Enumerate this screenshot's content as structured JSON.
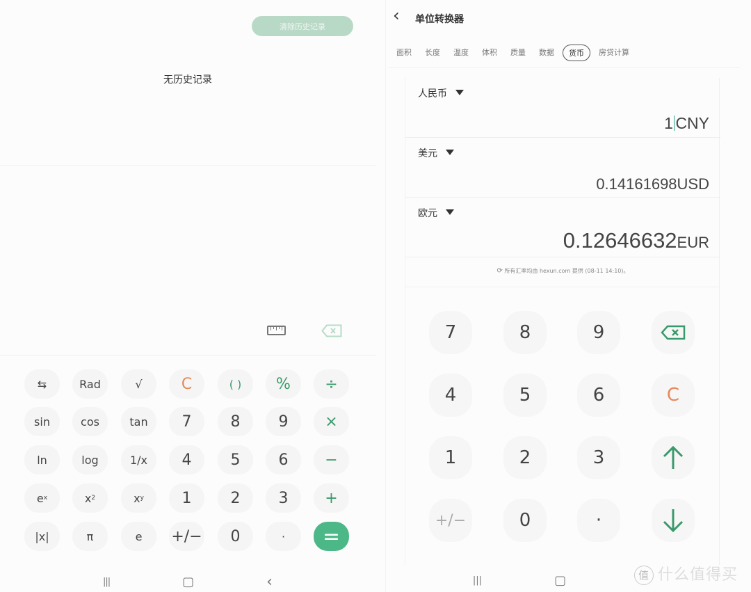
{
  "colors": {
    "accent": "#4cb887",
    "orange": "#e8875a",
    "green_text": "#3a9a6c",
    "clear_button_bg": "#b9d9c7"
  },
  "calculator": {
    "clear_history_label": "清除历史记录",
    "no_history": "无历史记录",
    "icons": {
      "ruler": "ruler-icon",
      "backspace": "backspace-icon"
    },
    "keys": [
      [
        {
          "t": "⇆",
          "n": "swap"
        },
        {
          "t": "Rad",
          "n": "rad"
        },
        {
          "t": "√",
          "n": "sqrt"
        },
        {
          "t": "C",
          "n": "clear",
          "c": "orange"
        },
        {
          "t": "( )",
          "n": "parentheses",
          "c": "green"
        },
        {
          "t": "%",
          "n": "percent",
          "c": "green"
        },
        {
          "t": "÷",
          "n": "divide",
          "c": "green"
        }
      ],
      [
        {
          "t": "sin",
          "n": "sin"
        },
        {
          "t": "cos",
          "n": "cos"
        },
        {
          "t": "tan",
          "n": "tan"
        },
        {
          "t": "7",
          "n": "7"
        },
        {
          "t": "8",
          "n": "8"
        },
        {
          "t": "9",
          "n": "9"
        },
        {
          "t": "×",
          "n": "multiply",
          "c": "green"
        }
      ],
      [
        {
          "t": "ln",
          "n": "ln"
        },
        {
          "t": "log",
          "n": "log"
        },
        {
          "t": "1/x",
          "n": "reciprocal"
        },
        {
          "t": "4",
          "n": "4"
        },
        {
          "t": "5",
          "n": "5"
        },
        {
          "t": "6",
          "n": "6"
        },
        {
          "t": "−",
          "n": "minus",
          "c": "green"
        }
      ],
      [
        {
          "t": "e",
          "s": "x",
          "n": "exp"
        },
        {
          "t": "x",
          "s": "2",
          "n": "square"
        },
        {
          "t": "x",
          "s": "y",
          "n": "power"
        },
        {
          "t": "1",
          "n": "1"
        },
        {
          "t": "2",
          "n": "2"
        },
        {
          "t": "3",
          "n": "3"
        },
        {
          "t": "+",
          "n": "plus",
          "c": "green"
        }
      ],
      [
        {
          "t": "|x|",
          "n": "abs"
        },
        {
          "t": "π",
          "n": "pi"
        },
        {
          "t": "e",
          "n": "e"
        },
        {
          "t": "+/−",
          "n": "negate"
        },
        {
          "t": "0",
          "n": "0"
        },
        {
          "t": "·",
          "n": "decimal"
        },
        {
          "t": "=",
          "n": "equals",
          "c": "accent"
        }
      ]
    ]
  },
  "navbar": {
    "recents": "|||",
    "home": "▢",
    "back": "‹"
  },
  "converter": {
    "back_icon": "‹",
    "title": "单位转换器",
    "tabs": [
      {
        "label": "面积"
      },
      {
        "label": "长度"
      },
      {
        "label": "温度"
      },
      {
        "label": "体积"
      },
      {
        "label": "质量"
      },
      {
        "label": "数据"
      },
      {
        "label": "货币",
        "active": true
      },
      {
        "label": "房贷计算"
      }
    ],
    "currencies": [
      {
        "name": "人民币",
        "value": "1",
        "unit": "CNY"
      },
      {
        "name": "美元",
        "value": "0.14161698",
        "unit": "USD"
      },
      {
        "name": "欧元",
        "value": "0.12646632",
        "unit": "EUR"
      }
    ],
    "source_note": "所有汇率均由 hexun.com 提供 (08-11 14:10)。",
    "keys": [
      [
        {
          "t": "7",
          "n": "7"
        },
        {
          "t": "8",
          "n": "8"
        },
        {
          "t": "9",
          "n": "9"
        },
        {
          "t": "",
          "n": "backspace",
          "icon": "backspace"
        }
      ],
      [
        {
          "t": "4",
          "n": "4"
        },
        {
          "t": "5",
          "n": "5"
        },
        {
          "t": "6",
          "n": "6"
        },
        {
          "t": "C",
          "n": "clear",
          "c": "orange"
        }
      ],
      [
        {
          "t": "1",
          "n": "1"
        },
        {
          "t": "2",
          "n": "2"
        },
        {
          "t": "3",
          "n": "3"
        },
        {
          "t": "",
          "n": "up",
          "icon": "arrow-up"
        }
      ],
      [
        {
          "t": "+/−",
          "n": "negate",
          "c": "light"
        },
        {
          "t": "0",
          "n": "0"
        },
        {
          "t": "·",
          "n": "decimal"
        },
        {
          "t": "",
          "n": "down",
          "icon": "arrow-down"
        }
      ]
    ]
  },
  "watermark": {
    "logo": "值",
    "text": "什么值得买"
  }
}
